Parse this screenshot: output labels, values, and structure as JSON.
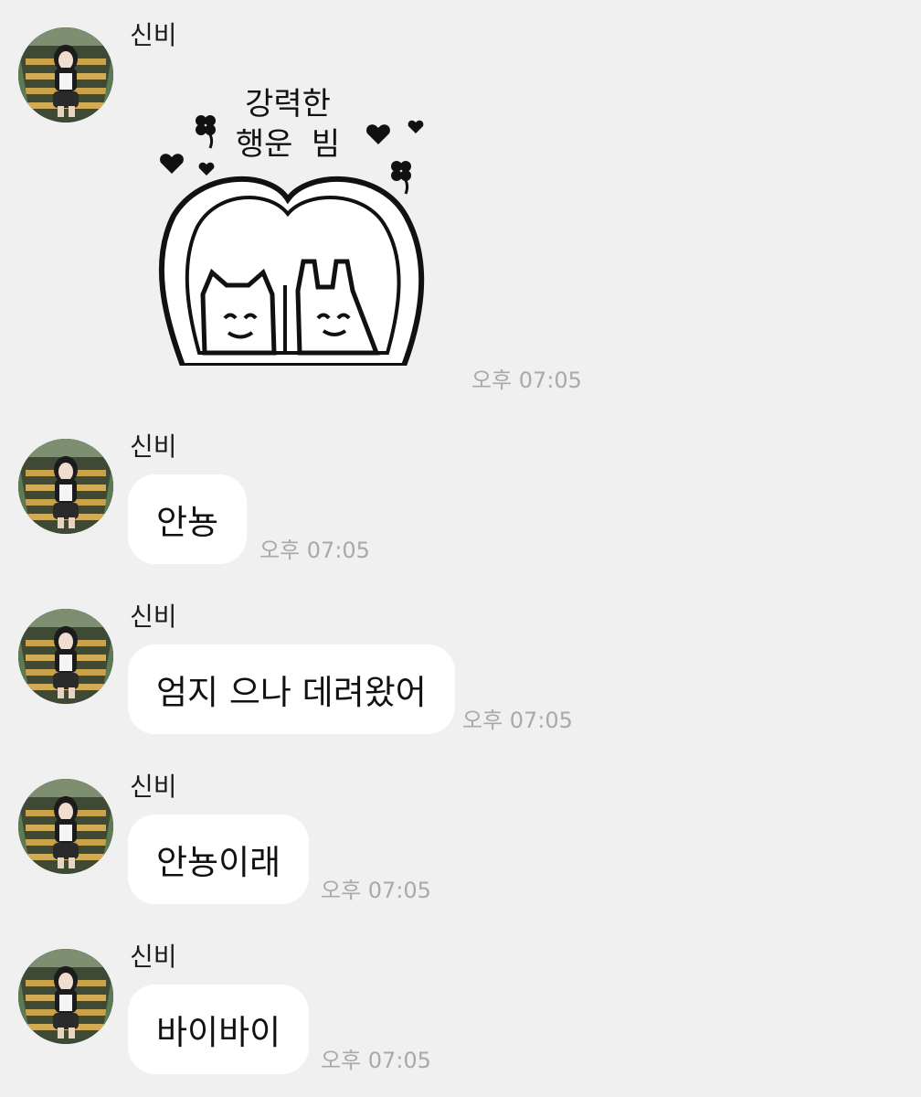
{
  "sender_name": "신비",
  "colors": {
    "background": "#f0f0f0",
    "bubble": "#ffffff",
    "text": "#111111",
    "timestamp": "#a9a9a9"
  },
  "messages": [
    {
      "type": "sticker",
      "sticker": {
        "line1": "강력한",
        "line2": "행운 빔",
        "description_icons": [
          "heart-icon",
          "clover-icon",
          "cat-icon",
          "bunny-icon"
        ]
      },
      "time": "오후 07:05"
    },
    {
      "type": "text",
      "text": "안뇽",
      "time": "오후 07:05"
    },
    {
      "type": "text",
      "text": "엄지 으나 데려왔어",
      "time": "오후 07:05"
    },
    {
      "type": "text",
      "text": "안뇽이래",
      "time": "오후 07:05"
    },
    {
      "type": "text",
      "text": "바이바이",
      "time": "오후 07:05"
    }
  ]
}
